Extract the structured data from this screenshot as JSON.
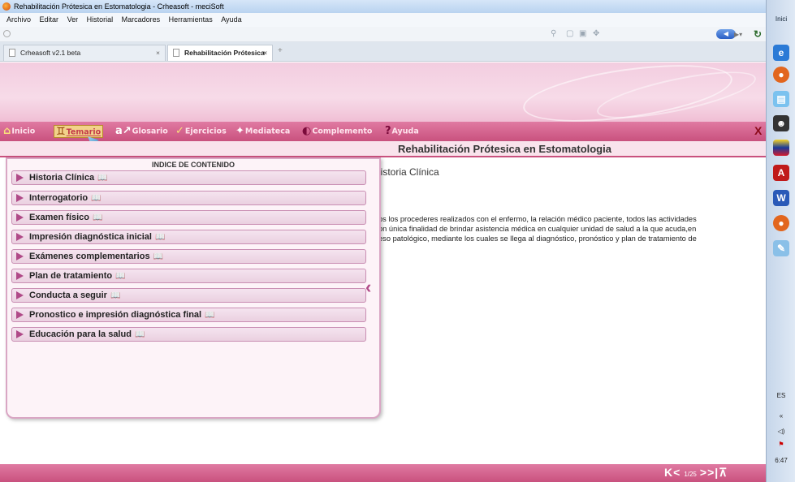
{
  "window": {
    "title": "Rehabilitación Prótesica en Estomatologia - Crheasoft - meciSoft"
  },
  "menu": [
    "Archivo",
    "Editar",
    "Ver",
    "Historial",
    "Marcadores",
    "Herramientas",
    "Ayuda"
  ],
  "tabs": [
    {
      "label": "Crheasoft v2.1 beta"
    },
    {
      "label": "Rehabilitación Prótesica en Estom..."
    }
  ],
  "app_nav": {
    "items": [
      {
        "label": "Inicio",
        "icon": "home-icon"
      },
      {
        "label": "Temario",
        "icon": "book-icon"
      },
      {
        "label": "Glosario",
        "icon": "glossary-icon"
      },
      {
        "label": "Ejercicios",
        "icon": "check-icon"
      },
      {
        "label": "Mediateca",
        "icon": "media-icon"
      },
      {
        "label": "Complemento",
        "icon": "complement-icon"
      },
      {
        "label": "Ayuda",
        "icon": "help-icon"
      }
    ],
    "close": "X"
  },
  "page_title": "Rehabilitación Prótesica en Estomatologia",
  "index": {
    "heading": "INDICE DE CONTENIDO",
    "items": [
      "Historia Clínica",
      "Interrogatorio",
      "Examen físico",
      "Impresión diagnóstica inicial",
      "Exámenes complementarios",
      "Plan de tratamiento",
      "Conducta a seguir",
      "Pronostico e impresión diagnóstica final",
      "Educación para la salud"
    ]
  },
  "content": {
    "section_title": "listoria Clínica",
    "lines": [
      "os los procederes realizados con el enfermo, la relación médico paciente, todos las actividades",
      "on única  finalidad de brindar asistencia médica en cualquier unidad de salud a la que acuda,en",
      "eso patológico, mediante los cuales se llega al diagnóstico, pronóstico y plan de tratamiento de",
      "."
    ]
  },
  "pager": {
    "current": "1/25"
  },
  "taskbar": {
    "start": "Inici",
    "lang": "ES",
    "time": "6:47"
  }
}
